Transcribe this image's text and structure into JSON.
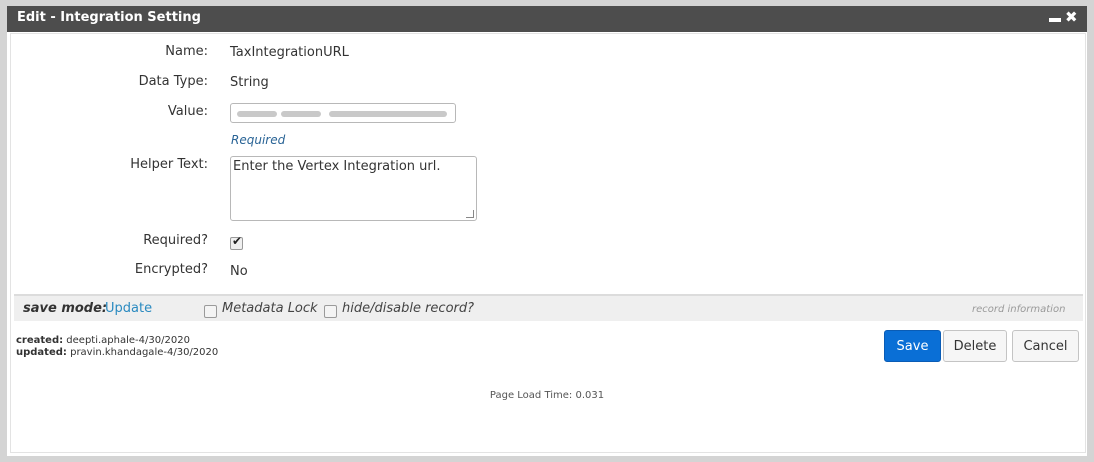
{
  "dialog": {
    "title": "Edit - Integration Setting",
    "minimize_icon": "minimize-icon",
    "close_icon": "close-icon",
    "close_glyph": "✖"
  },
  "form": {
    "name_label": "Name:",
    "name_value": "TaxIntegrationURL",
    "datatype_label": "Data Type:",
    "datatype_value": "String",
    "value_label": "Value:",
    "value_required_note": "Required",
    "helper_label": "Helper Text:",
    "helper_value": "Enter the Vertex Integration url.",
    "required_label": "Required?",
    "required_checked": true,
    "encrypted_label": "Encrypted?",
    "encrypted_value": "No"
  },
  "mode_bar": {
    "save_mode_label": "save mode:",
    "save_mode_value": "Update",
    "metadata_lock_label": "Metadata Lock",
    "hide_disable_label": "hide/disable record?",
    "record_info_label": "record information"
  },
  "meta": {
    "created_label": "created:",
    "created_value": "deepti.aphale-4/30/2020",
    "updated_label": "updated:",
    "updated_value": "pravin.khandagale-4/30/2020"
  },
  "buttons": {
    "save": "Save",
    "delete": "Delete",
    "cancel": "Cancel"
  },
  "footer": {
    "page_load": "Page Load Time: 0.031"
  },
  "colors": {
    "titlebar": "#4d4d4d",
    "primary": "#0a6fd6",
    "link": "#2a8ac0"
  }
}
